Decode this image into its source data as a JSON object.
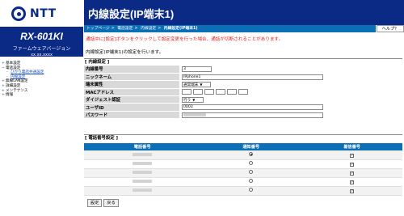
{
  "brand": {
    "logo_text": "NTT",
    "model": "RX-601KI",
    "fw_label": "ファームウェアバージョン",
    "fw_version": "xx.xx.xxxx"
  },
  "menu": [
    {
      "label": "基本設定",
      "level": 0
    },
    {
      "label": "電話設定",
      "level": 0
    },
    {
      "label": "ひかり電話共通設定",
      "level": 1
    },
    {
      "label": "内線設定",
      "level": 1
    },
    {
      "label": "無線LAN設定",
      "level": 0
    },
    {
      "label": "詳細設定",
      "level": 0
    },
    {
      "label": "メンテナンス",
      "level": 0
    },
    {
      "label": "情報",
      "level": 0
    }
  ],
  "page_title": "内線設定(IP端末1)",
  "breadcrumb": [
    "トップページ",
    "電話設定",
    "内線設定",
    "内線設定(IP端末1)"
  ],
  "help_label": "ヘルプ？",
  "warning": "通話中に[設定]ボタンをクリックして設定変更を行った場合、通話が切断されることがあります。",
  "description": "内線設定(IP端末1)の設定を行います。",
  "extension_section": {
    "title": "[ 内線設定 ]",
    "fields": {
      "number": {
        "label": "内線番号",
        "value": "3"
      },
      "nickname": {
        "label": "ニックネーム",
        "value": "IPphone1"
      },
      "ring_type": {
        "label": "端末属性",
        "value": "通常端末"
      },
      "mac": {
        "label": "MACアドレス",
        "value": [
          "",
          "",
          "",
          "",
          "",
          ""
        ]
      },
      "digest": {
        "label": "ダイジェスト認証",
        "value": "行う"
      },
      "user_id": {
        "label": "ユーザID",
        "value": "0003"
      },
      "password": {
        "label": "パスワード",
        "value": ""
      }
    }
  },
  "phone_section": {
    "title": "[ 電話番号設定 ]",
    "headers": [
      "電話番号",
      "通知番号",
      "着信番号"
    ],
    "rows": [
      {
        "notify": true,
        "incoming": true
      },
      {
        "notify": false,
        "incoming": true
      },
      {
        "notify": false,
        "incoming": true
      },
      {
        "notify": false,
        "incoming": true
      },
      {
        "notify": false,
        "incoming": true
      }
    ]
  },
  "buttons": {
    "set": "設定",
    "back": "戻る"
  },
  "colors": {
    "navy": "#0b2a86",
    "blue": "#0b6fb8",
    "warning": "#e0201c"
  }
}
